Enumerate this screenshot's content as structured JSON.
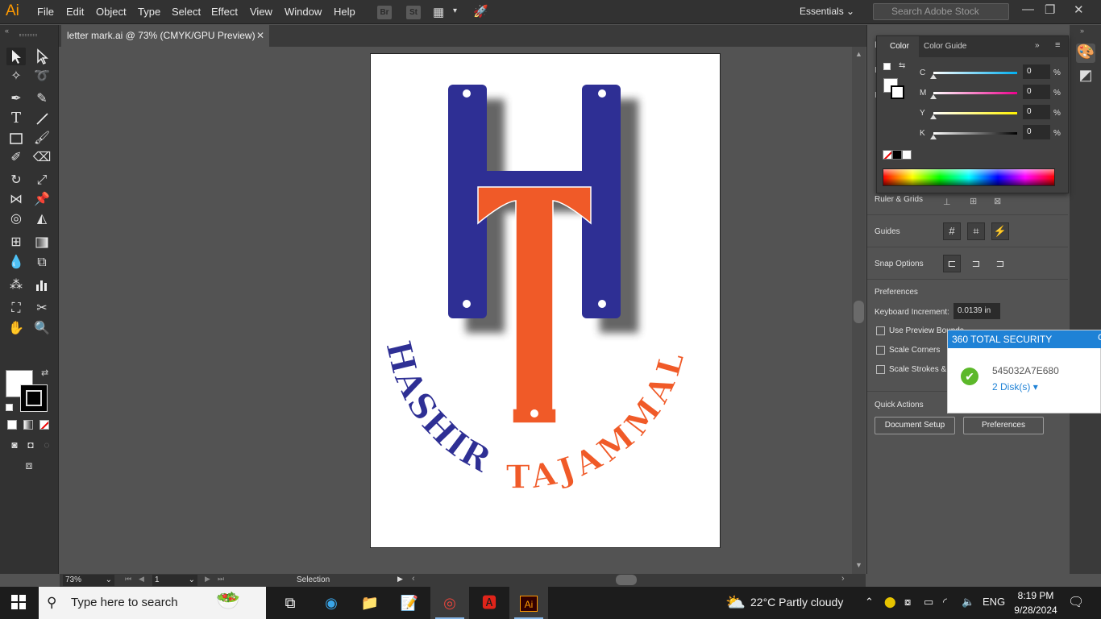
{
  "app": {
    "logo": "Ai",
    "menu": [
      "File",
      "Edit",
      "Object",
      "Type",
      "Select",
      "Effect",
      "View",
      "Window",
      "Help"
    ],
    "bridge_buttons": [
      "Br",
      "St"
    ],
    "workspace": "Essentials",
    "stock_search_placeholder": "Search Adobe Stock"
  },
  "document": {
    "tab_title": "letter mark.ai @ 73% (CMYK/GPU Preview)",
    "zoom": "73%",
    "page": "1",
    "status": "Selection"
  },
  "artwork": {
    "left_text": "HASHIR",
    "right_text": "TAJAMMAL",
    "colors": {
      "blue": "#2e2f94",
      "orange": "#f05a28"
    }
  },
  "color_panel": {
    "tabs": [
      "Color",
      "Color Guide"
    ],
    "channels": [
      {
        "label": "C",
        "value": "0",
        "unit": "%"
      },
      {
        "label": "M",
        "value": "0",
        "unit": "%"
      },
      {
        "label": "Y",
        "value": "0",
        "unit": "%"
      },
      {
        "label": "K",
        "value": "0",
        "unit": "%"
      }
    ]
  },
  "properties": {
    "ruler_grids_label": "Ruler & Grids",
    "guides_label": "Guides",
    "snap_label": "Snap Options",
    "preferences_label": "Preferences",
    "keyboard_increment_label": "Keyboard Increment:",
    "keyboard_increment_value": "0.0139 in",
    "checkbox_preview_bounds": "Use Preview Bounds",
    "checkbox_scale_corners": "Scale Corners",
    "checkbox_scale_strokes": "Scale Strokes &",
    "quick_actions_label": "Quick Actions",
    "document_setup_btn": "Document Setup",
    "preferences_btn": "Preferences"
  },
  "notification": {
    "title": "360 TOTAL SECURITY",
    "id": "545032A7E680",
    "disks": "2 Disk(s)"
  },
  "taskbar": {
    "search_placeholder": "Type here to search",
    "weather_temp": "22°C",
    "weather_desc": "Partly cloudy",
    "language": "ENG",
    "time": "8:19 PM",
    "date": "9/28/2024"
  }
}
